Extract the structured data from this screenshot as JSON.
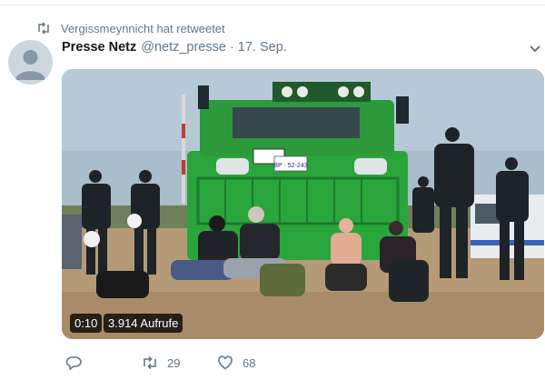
{
  "retweet_context": {
    "icon": "retweet-icon",
    "text": "Vergissmeynnicht hat retweetet"
  },
  "tweet": {
    "author_name": "Presse Netz",
    "author_handle": "@netz_presse",
    "separator": "·",
    "date": "17. Sep.",
    "menu_icon": "chevron-down-icon"
  },
  "video": {
    "duration": "0:10",
    "views": "3.914 Aufrufe",
    "vehicle_plate": "BP · 52-243",
    "colors": {
      "sky": "#9fb6c6",
      "vehicle": "#2aa53c",
      "ground": "#b59a78"
    }
  },
  "actions": {
    "reply": {
      "icon": "reply-icon",
      "count": ""
    },
    "retweet": {
      "icon": "retweet-icon",
      "count": "29"
    },
    "like": {
      "icon": "heart-icon",
      "count": "68"
    }
  },
  "colors": {
    "secondary_text": "#657786",
    "divider": "#e6ecf0"
  }
}
